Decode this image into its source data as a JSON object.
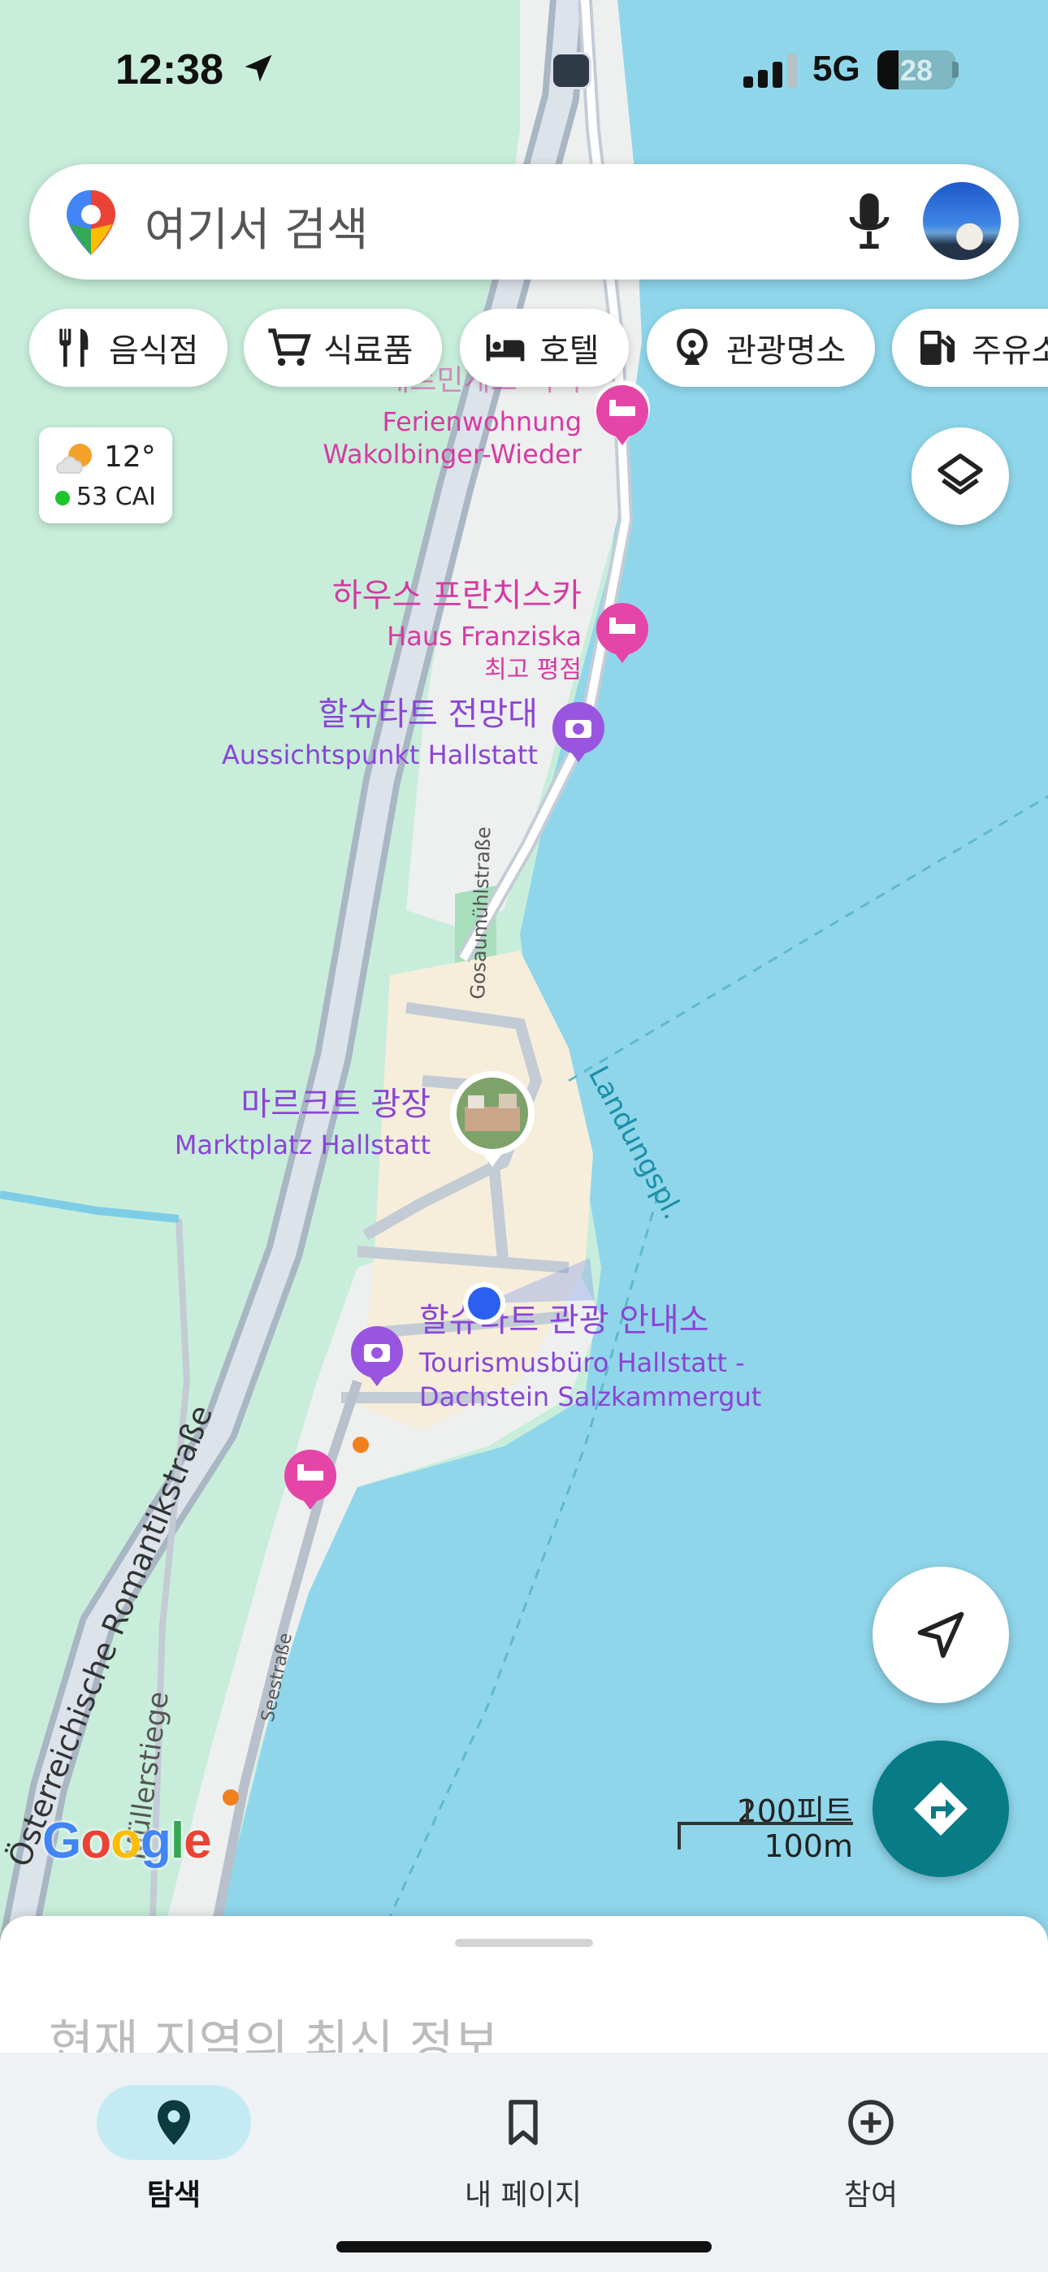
{
  "status_bar": {
    "time": "12:38",
    "network": "5G",
    "battery": "28"
  },
  "search": {
    "placeholder": "여기서 검색"
  },
  "chips": [
    {
      "label": "음식점",
      "icon": "restaurant-icon"
    },
    {
      "label": "식료품",
      "icon": "cart-icon"
    },
    {
      "label": "호텔",
      "icon": "bed-icon"
    },
    {
      "label": "관광명소",
      "icon": "attraction-icon"
    },
    {
      "label": "주유소",
      "icon": "gas-station-icon"
    }
  ],
  "weather": {
    "temperature": "12°",
    "air_quality": "53 CAI",
    "icon": "partly-cloudy-icon"
  },
  "map": {
    "places": {
      "ferienwohnung_partial": "패르민게르-비더",
      "ferienwohnung": [
        "Ferienwohnung",
        "Wakolbinger-Wieder"
      ],
      "haus_franziska_ko": "하우스 프란치스카",
      "haus_franziska": "Haus Franziska",
      "haus_franziska_badge": "최고 평점",
      "viewpoint_ko": "할슈타트 전망대",
      "viewpoint": "Aussichtspunkt Hallstatt",
      "marktplatz_ko": "마르크트 광장",
      "marktplatz": "Marktplatz Hallstatt",
      "tourist_office_ko": "할슈타트 관광 안내소",
      "tourist_office": [
        "Tourismusbüro Hallstatt -",
        "Dachstein Salzkammergut"
      ]
    },
    "streets": {
      "gosaumuhl": "Gosaumühlstraße",
      "landung": "Landungspl.",
      "romantik": "Österreichische Romantikstraße",
      "seestrasse": "Seestraße",
      "mullerstiege": "Müllerstiege"
    },
    "colors": {
      "water": "#8fd6ea",
      "land": "#c8eedb",
      "town": "#f6eedb",
      "road": "#b9c4d0",
      "hotel_pin": "#e645a8",
      "attraction_pin": "#9a55e0"
    }
  },
  "scale": {
    "feet": "200피트",
    "meters": "100m"
  },
  "branding": {
    "logo": [
      "G",
      "o",
      "o",
      "g",
      "l",
      "e"
    ],
    "logo_colors": [
      "#4285F4",
      "#EA4335",
      "#FBBC05",
      "#4285F4",
      "#34A853",
      "#EA4335"
    ]
  },
  "sheet": {
    "title": "현재 지역의 최신 정보..."
  },
  "nav": [
    {
      "label": "탐색",
      "icon": "explore-pin-icon",
      "active": true
    },
    {
      "label": "내 페이지",
      "icon": "bookmark-icon",
      "active": false
    },
    {
      "label": "참여",
      "icon": "add-circle-icon",
      "active": false
    }
  ]
}
